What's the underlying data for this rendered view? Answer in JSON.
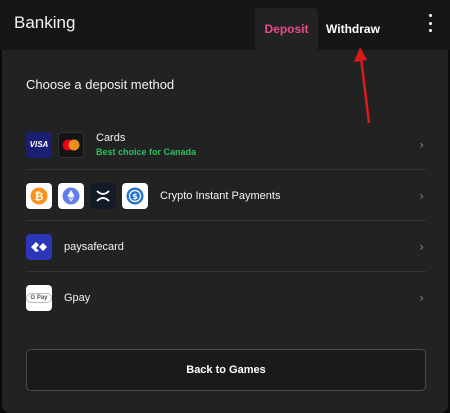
{
  "header": {
    "title": "Banking",
    "tabs": [
      {
        "label": "Deposit",
        "active": true
      },
      {
        "label": "Withdraw",
        "active": false
      }
    ],
    "menu_icon": "kebab-menu-icon"
  },
  "main": {
    "heading": "Choose a deposit method",
    "methods": [
      {
        "label": "Cards",
        "sublabel": "Best choice for Canada",
        "icons": [
          "visa-icon",
          "mastercard-icon"
        ]
      },
      {
        "label": "Crypto Instant Payments",
        "icons": [
          "bitcoin-icon",
          "ethereum-icon",
          "xrp-icon",
          "usdc-icon"
        ]
      },
      {
        "label": "paysafecard",
        "icons": [
          "paysafecard-icon"
        ]
      },
      {
        "label": "Gpay",
        "icons": [
          "gpay-icon"
        ]
      }
    ],
    "visa_text": "VISA",
    "gpay_text": "G Pay",
    "back_button": "Back to Games"
  },
  "colors": {
    "active_tab": "#e74c8c",
    "best_choice": "#2bbf60",
    "annotation_arrow": "#d81b1b"
  }
}
